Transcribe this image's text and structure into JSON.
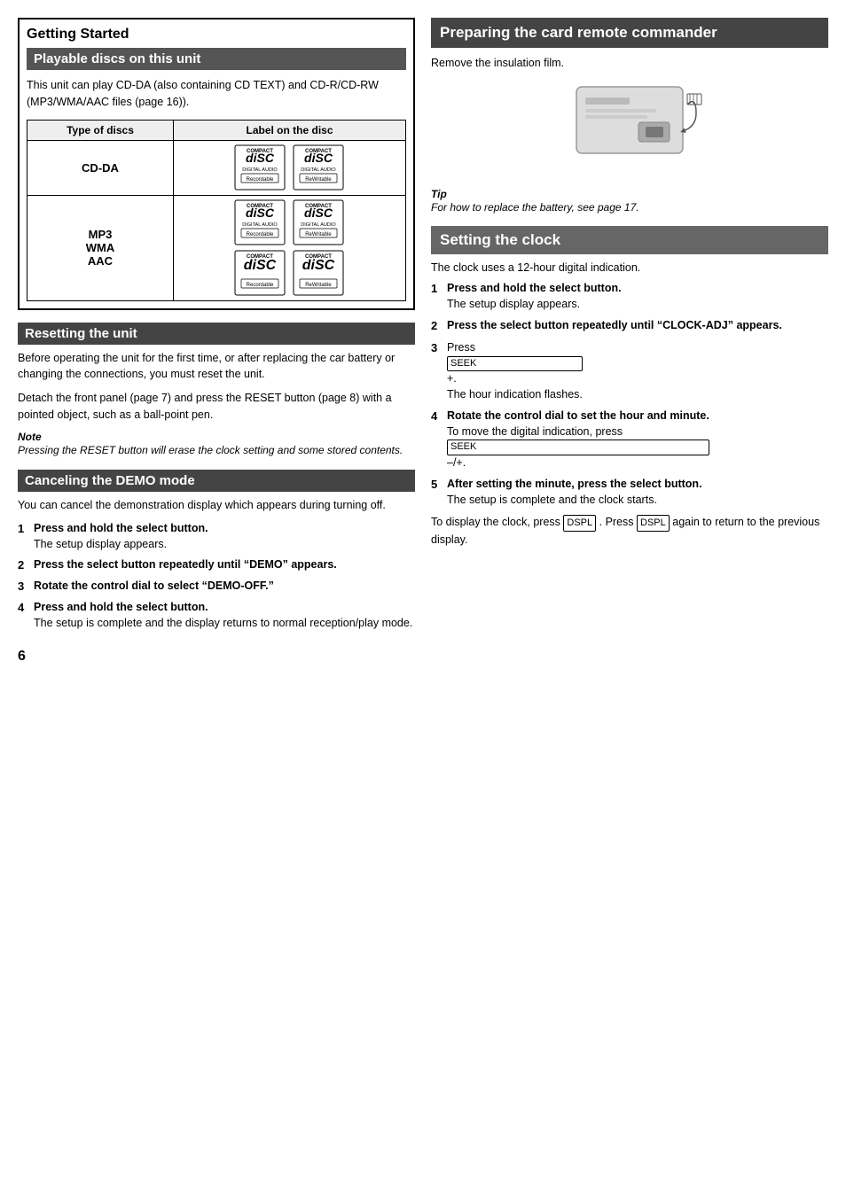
{
  "left": {
    "getting_started": {
      "title": "Getting Started",
      "playable_discs": {
        "header": "Playable discs on this unit",
        "intro": "This unit can play CD-DA (also containing CD TEXT) and CD-R/CD-RW (MP3/WMA/AAC files (page 16)).",
        "table": {
          "col1": "Type of discs",
          "col2": "Label on the disc",
          "rows": [
            {
              "type": "CD-DA",
              "discs": [
                {
                  "top": "COMPACT",
                  "middle": "DISC",
                  "sub": "DIGITAL AUDIO",
                  "bottom": "Recordable"
                },
                {
                  "top": "COMPACT",
                  "middle": "DISC",
                  "sub": "DIGITAL AUDIO",
                  "bottom": "ReWritable"
                }
              ]
            },
            {
              "type": "MP3\nWMA\nAAC",
              "discs": [
                {
                  "top": "COMPACT",
                  "middle": "DISC",
                  "sub": "DIGITAL AUDIO",
                  "bottom": "Recordable"
                },
                {
                  "top": "COMPACT",
                  "middle": "DISC",
                  "sub": "DIGITAL AUDIO",
                  "bottom": "ReWritable"
                },
                {
                  "top": "COMPACT",
                  "middle": "DISC",
                  "sub": "",
                  "bottom": "Recordable"
                },
                {
                  "top": "COMPACT",
                  "middle": "DISC",
                  "sub": "",
                  "bottom": "ReWritable"
                }
              ]
            }
          ]
        }
      }
    },
    "resetting": {
      "header": "Resetting the unit",
      "body1": "Before operating the unit for the first time, or after replacing the car battery or changing the connections, you must reset the unit.",
      "body2": "Detach the front panel (page 7) and press the RESET button (page 8) with a pointed object, such as a ball-point pen.",
      "note_label": "Note",
      "note_text": "Pressing the RESET button will erase the clock setting and some stored contents."
    },
    "demo": {
      "header": "Canceling the DEMO mode",
      "intro": "You can cancel the demonstration display which appears during turning off.",
      "steps": [
        {
          "num": "1",
          "bold": "Press and hold the select button.",
          "sub": "The setup display appears."
        },
        {
          "num": "2",
          "bold": "Press the select button repeatedly until “DEMO” appears.",
          "sub": ""
        },
        {
          "num": "3",
          "bold": "Rotate the control dial to select “DEMO-OFF.”",
          "sub": ""
        },
        {
          "num": "4",
          "bold": "Press and hold the select button.",
          "sub": "The setup is complete and the display returns to normal reception/play mode."
        }
      ]
    }
  },
  "right": {
    "preparing": {
      "header": "Preparing the card remote commander",
      "intro": "Remove the insulation film.",
      "tip_label": "Tip",
      "tip_text": "For how to replace the battery, see page 17."
    },
    "clock": {
      "header": "Setting the clock",
      "intro": "The clock uses a 12-hour digital indication.",
      "steps": [
        {
          "num": "1",
          "bold": "Press and hold the select button.",
          "sub": "The setup display appears."
        },
        {
          "num": "2",
          "bold": "Press the select button repeatedly until “CLOCK-ADJ” appears.",
          "sub": ""
        },
        {
          "num": "3",
          "bold": "Press",
          "kbd": "SEEK",
          "bold2": "+.",
          "sub": "The hour indication flashes."
        },
        {
          "num": "4",
          "bold": "Rotate the control dial to set the hour and minute.",
          "sub": "To move the digital indication, press",
          "sub_kbd": "SEEK",
          "sub_end": "–/+."
        },
        {
          "num": "5",
          "bold": "After setting the minute, press the select button.",
          "sub": "The setup is complete and the clock starts."
        }
      ],
      "footer": "To display the clock, press",
      "footer_kbd1": "DSPL",
      "footer_mid": ". Press",
      "footer_kbd2": "DSPL",
      "footer_end": "again to return to the previous display."
    }
  },
  "page_number": "6"
}
